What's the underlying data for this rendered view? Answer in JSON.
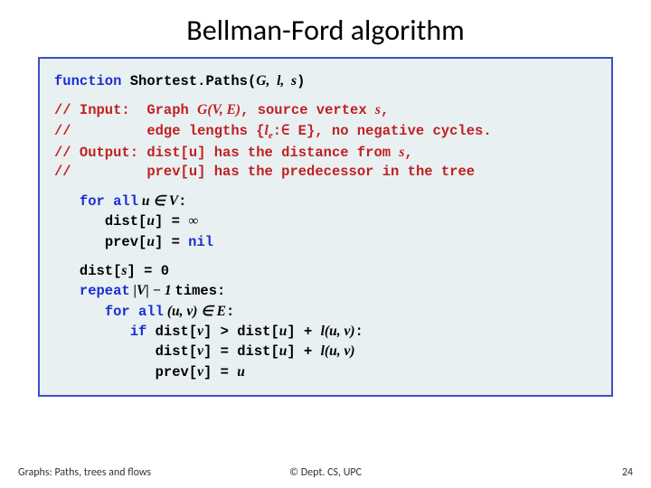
{
  "title": "Bellman-Ford algorithm",
  "code": {
    "fn_kw": "function",
    "fn_name": "Shortest.Paths",
    "fn_args_open": "(",
    "fn_args": "G,  l,  s",
    "fn_args_close": ")",
    "c1": "// Input:  Graph ",
    "c1a": "G(V, E)",
    "c1b": ", source vertex ",
    "c1c": "s",
    "c1d": ",",
    "c2": "//         edge lengths {",
    "c2a": "l",
    "c2a_sub": "e",
    "c2b": ":∈ E}, no negative cycles.",
    "c3": "// Output: dist[u] has the distance from ",
    "c3a": "s",
    "c3b": ",",
    "c4": "//         prev[u] has the predecessor in the tree",
    "for_all1": "for all",
    "forall1_expr": " u ∈ V",
    "colon": ":",
    "init_dist": "dist[",
    "u": "u",
    "close_br": "]",
    "eq": " = ",
    "inf": "∞",
    "init_prev": "prev[",
    "nil": "nil",
    "dist_s_lhs": "dist[",
    "s": "s",
    "zero": "0",
    "repeat": "repeat",
    "rep_expr_a": " |V| − 1 ",
    "times": "times",
    "for_all2": "for all",
    "forall2_expr": " (u, v) ∈ E",
    "if": "if",
    "cond_l": " dist[",
    "v": "v",
    "cond_mid": "] > dist[",
    "cond_r": "] + ",
    "lfn": "l",
    "lfn_args": "(u, v)",
    "assign_dist_l": "dist[",
    "assign_dist_mid": "] = dist[",
    "assign_dist_r": "] + ",
    "assign_prev_l": "prev[",
    "assign_prev_r": "] = "
  },
  "footer": {
    "left": "Graphs: Paths, trees and flows",
    "mid": "© Dept. CS, UPC",
    "right": "24"
  }
}
